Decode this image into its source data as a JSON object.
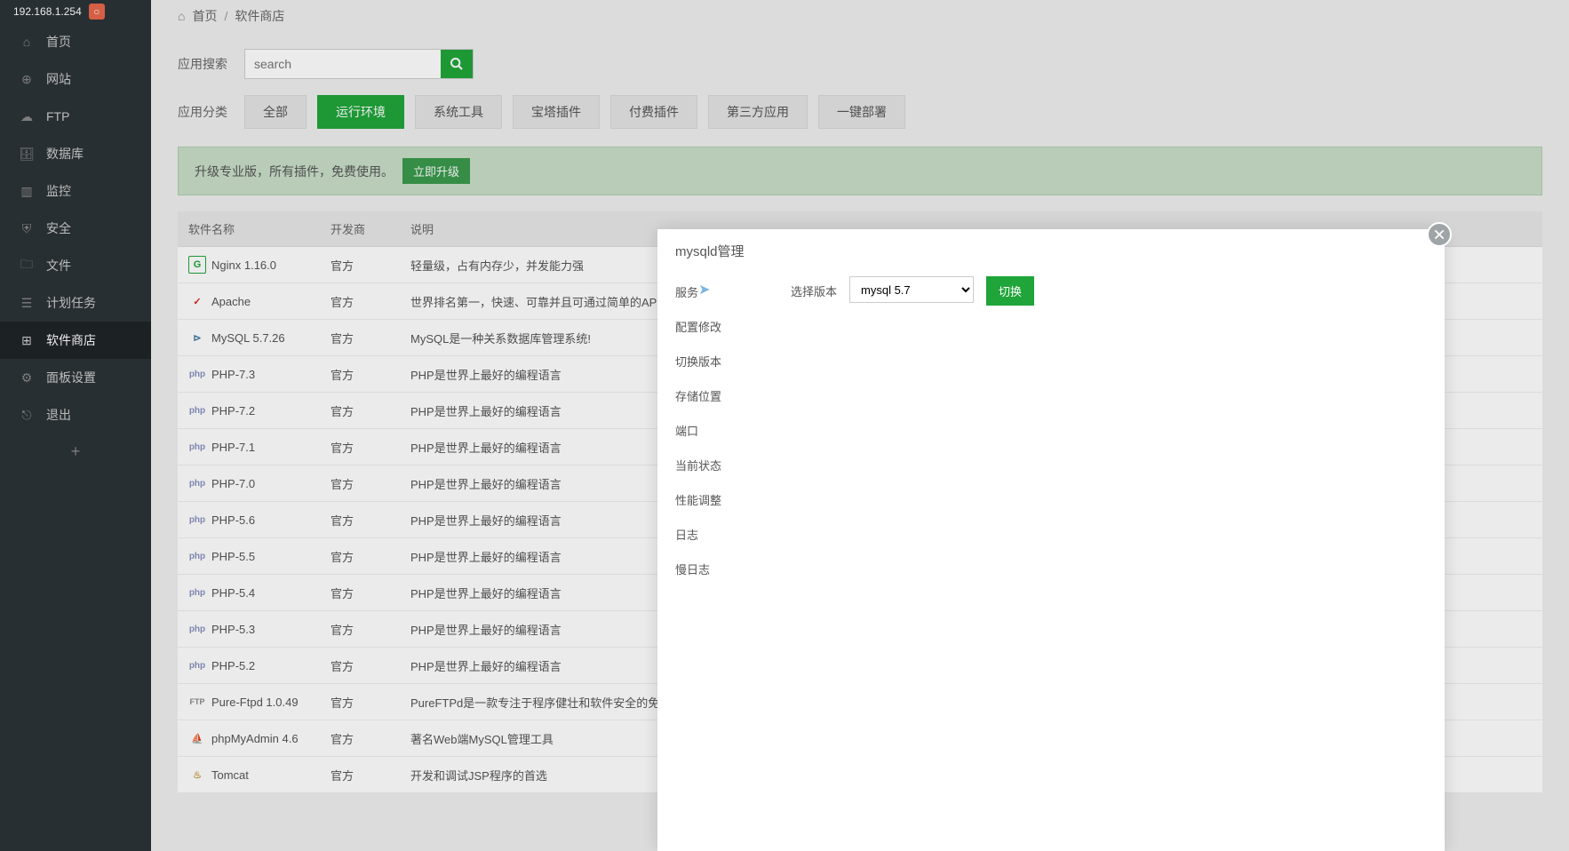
{
  "sidebar": {
    "host": "192.168.1.254",
    "items": [
      {
        "label": "首页",
        "icon": "home"
      },
      {
        "label": "网站",
        "icon": "globe"
      },
      {
        "label": "FTP",
        "icon": "cloud"
      },
      {
        "label": "数据库",
        "icon": "database"
      },
      {
        "label": "监控",
        "icon": "chart"
      },
      {
        "label": "安全",
        "icon": "shield"
      },
      {
        "label": "文件",
        "icon": "folder"
      },
      {
        "label": "计划任务",
        "icon": "calendar"
      },
      {
        "label": "软件商店",
        "icon": "grid",
        "active": true
      },
      {
        "label": "面板设置",
        "icon": "gear"
      },
      {
        "label": "退出",
        "icon": "exit"
      }
    ]
  },
  "breadcrumb": {
    "home": "首页",
    "current": "软件商店"
  },
  "search": {
    "label": "应用搜索",
    "placeholder": "search"
  },
  "category": {
    "label": "应用分类",
    "tabs": [
      "全部",
      "运行环境",
      "系统工具",
      "宝塔插件",
      "付费插件",
      "第三方应用",
      "一键部署"
    ],
    "active": 1
  },
  "notice": {
    "text": "升级专业版，所有插件，免费使用。",
    "button": "立即升级"
  },
  "table": {
    "headers": [
      "软件名称",
      "开发商",
      "说明"
    ],
    "rows": [
      {
        "name": "Nginx 1.16.0",
        "dev": "官方",
        "desc": "轻量级，占有内存少，并发能力强",
        "icon": "nginx",
        "iconText": "G"
      },
      {
        "name": "Apache",
        "dev": "官方",
        "desc": "世界排名第一，快速、可靠并且可通过简单的API扩充",
        "icon": "apache",
        "iconText": "✓"
      },
      {
        "name": "MySQL 5.7.26",
        "dev": "官方",
        "desc": "MySQL是一种关系数据库管理系统!",
        "icon": "mysql",
        "iconText": "⊳"
      },
      {
        "name": "PHP-7.3",
        "dev": "官方",
        "desc": "PHP是世界上最好的编程语言",
        "icon": "php",
        "iconText": "php"
      },
      {
        "name": "PHP-7.2",
        "dev": "官方",
        "desc": "PHP是世界上最好的编程语言",
        "icon": "php",
        "iconText": "php"
      },
      {
        "name": "PHP-7.1",
        "dev": "官方",
        "desc": "PHP是世界上最好的编程语言",
        "icon": "php",
        "iconText": "php"
      },
      {
        "name": "PHP-7.0",
        "dev": "官方",
        "desc": "PHP是世界上最好的编程语言",
        "icon": "php",
        "iconText": "php"
      },
      {
        "name": "PHP-5.6",
        "dev": "官方",
        "desc": "PHP是世界上最好的编程语言",
        "icon": "php",
        "iconText": "php"
      },
      {
        "name": "PHP-5.5",
        "dev": "官方",
        "desc": "PHP是世界上最好的编程语言",
        "icon": "php",
        "iconText": "php"
      },
      {
        "name": "PHP-5.4",
        "dev": "官方",
        "desc": "PHP是世界上最好的编程语言",
        "icon": "php",
        "iconText": "php"
      },
      {
        "name": "PHP-5.3",
        "dev": "官方",
        "desc": "PHP是世界上最好的编程语言",
        "icon": "php",
        "iconText": "php"
      },
      {
        "name": "PHP-5.2",
        "dev": "官方",
        "desc": "PHP是世界上最好的编程语言",
        "icon": "php",
        "iconText": "php"
      },
      {
        "name": "Pure-Ftpd 1.0.49",
        "dev": "官方",
        "desc": "PureFTPd是一款专注于程序健壮和软件安全的免费FTP服务器软件",
        "icon": "ftp",
        "iconText": "FTP"
      },
      {
        "name": "phpMyAdmin 4.6",
        "dev": "官方",
        "desc": "著名Web端MySQL管理工具",
        "icon": "pma",
        "iconText": "⛵"
      },
      {
        "name": "Tomcat",
        "dev": "官方",
        "desc": "开发和调试JSP程序的首选",
        "icon": "tomcat",
        "iconText": "♨"
      }
    ]
  },
  "modal": {
    "title": "mysqld管理",
    "side": [
      "服务",
      "配置修改",
      "切换版本",
      "存储位置",
      "端口",
      "当前状态",
      "性能调整",
      "日志",
      "慢日志"
    ],
    "version_label": "选择版本",
    "version_value": "mysql 5.7",
    "switch_button": "切换"
  }
}
